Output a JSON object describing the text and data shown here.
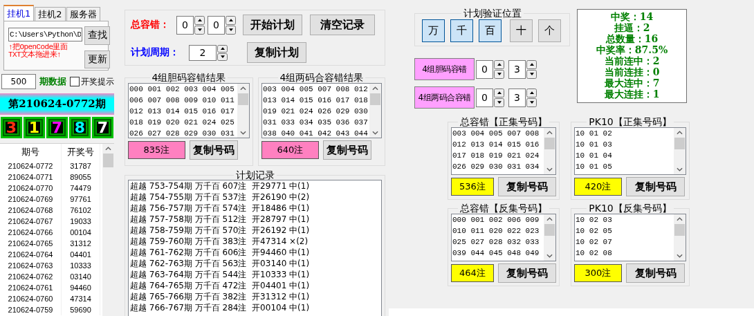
{
  "tabs": [
    {
      "label": "挂机1",
      "selected": true
    },
    {
      "label": "挂机2",
      "selected": false
    },
    {
      "label": "服务器",
      "selected": false
    }
  ],
  "file_path": "C:\\Users\\Python\\D",
  "find_button": "查找",
  "update_button": "更新",
  "drag_hint_lines": [
    "↑把OpenCode里面",
    "TXT文本拖进来↑"
  ],
  "period_count": "500",
  "period_label": "期数据",
  "notify": {
    "label": "开奖提示",
    "checked": false
  },
  "current_period": "第210624-0772期",
  "draw_digits": [
    "3",
    "1",
    "7",
    "8",
    "7"
  ],
  "history_table": {
    "columns": [
      "期号",
      "开奖号"
    ],
    "rows": [
      [
        "210624-0772",
        "31787"
      ],
      [
        "210624-0771",
        "89055"
      ],
      [
        "210624-0770",
        "74479"
      ],
      [
        "210624-0769",
        "97761"
      ],
      [
        "210624-0768",
        "76102"
      ],
      [
        "210624-0767",
        "19033"
      ],
      [
        "210624-0766",
        "00104"
      ],
      [
        "210624-0765",
        "31312"
      ],
      [
        "210624-0764",
        "04401"
      ],
      [
        "210624-0763",
        "10333"
      ],
      [
        "210624-0762",
        "03140"
      ],
      [
        "210624-0761",
        "94460"
      ],
      [
        "210624-0760",
        "47314"
      ],
      [
        "210624-0759",
        "59690"
      ]
    ]
  },
  "tolerance": {
    "label": "总容错：",
    "values": [
      "0",
      "0"
    ]
  },
  "cycle": {
    "label": "计划周期：",
    "value": "2"
  },
  "start_button": "开始计划",
  "clear_button": "清空记录",
  "copy_plan_button": "复制计划",
  "result_groups": [
    {
      "title": "4组胆码容错结果",
      "lines": [
        "000 001 002 003 004 005",
        "006 007 008 009 010 011",
        "012 013 014 015 016 017",
        "018 019 020 021 024 025",
        "026 027 028 029 030 031"
      ],
      "count": "835注",
      "copy_button": "复制号码"
    },
    {
      "title": "4组两码合容错结果",
      "lines": [
        "003 004 005 007 008 012",
        "013 014 015 016 017 018",
        "019 021 024 026 029 030",
        "031 033 034 035 036 037",
        "038 040 041 042 043 044"
      ],
      "count": "640注",
      "copy_button": "复制号码"
    }
  ],
  "plan_log": {
    "title": "计划记录",
    "entries": [
      "超越 753-754期 万千百 607注  开29771 中(1)",
      "超越 754-755期 万千百 537注  开26190 中(2)",
      "超越 756-757期 万千百 574注  开18486 中(1)",
      "超越 757-758期 万千百 512注  开28797 中(1)",
      "超越 758-759期 万千百 570注  开26192 中(1)",
      "超越 759-760期 万千百 383注  开47314 ×(2)",
      "超越 761-762期 万千百 606注  开94460 中(1)",
      "超越 762-763期 万千百 563注  开03140 中(1)",
      "超越 763-764期 万千百 544注  开10333 中(1)",
      "超越 764-765期 万千百 472注  开04401 中(1)",
      "超越 765-766期 万千百 382注  开31312 中(1)",
      "超越 766-767期 万千百 284注  开00104 中(1)"
    ]
  },
  "positions": {
    "title": "计划验证位置",
    "items": [
      {
        "label": "万",
        "selected": true
      },
      {
        "label": "千",
        "selected": true
      },
      {
        "label": "百",
        "selected": true
      },
      {
        "label": "十",
        "selected": false
      },
      {
        "label": "个",
        "selected": false
      }
    ]
  },
  "tolerance_settings": [
    {
      "label": "4组胆码容错",
      "values": [
        "0",
        "3"
      ]
    },
    {
      "label": "4组两码合容错",
      "values": [
        "0",
        "3"
      ]
    }
  ],
  "stats": [
    "中奖：14",
    "挂逼：2",
    "总数量：16",
    "中奖率：87.5%",
    "当前连中：2",
    "当前连挂：0",
    "最大连中：7",
    "最大连挂：1"
  ],
  "sets": [
    {
      "title": "总容错【正集号码】",
      "lines": [
        "003 004 005 007 008",
        "012 013 014 015 016",
        "017 018 019 021 024",
        "026 029 030 031 034"
      ],
      "count": "536注",
      "copy_button": "复制号码"
    },
    {
      "title": "PK10【正集号码】",
      "lines": [
        "10 01 02",
        "10 01 03",
        "10 01 04",
        "10 01 05"
      ],
      "count": "420注",
      "copy_button": "复制号码"
    },
    {
      "title": "总容错【反集号码】",
      "lines": [
        "000 001 002 006 009",
        "010 011 020 022 023",
        "025 027 028 032 033",
        "039 044 045 048 049"
      ],
      "count": "464注",
      "copy_button": "复制号码"
    },
    {
      "title": "PK10【反集号码】",
      "lines": [
        "10 02 03",
        "10 02 05",
        "10 02 07",
        "10 02 08"
      ],
      "count": "300注",
      "copy_button": "复制号码"
    }
  ]
}
